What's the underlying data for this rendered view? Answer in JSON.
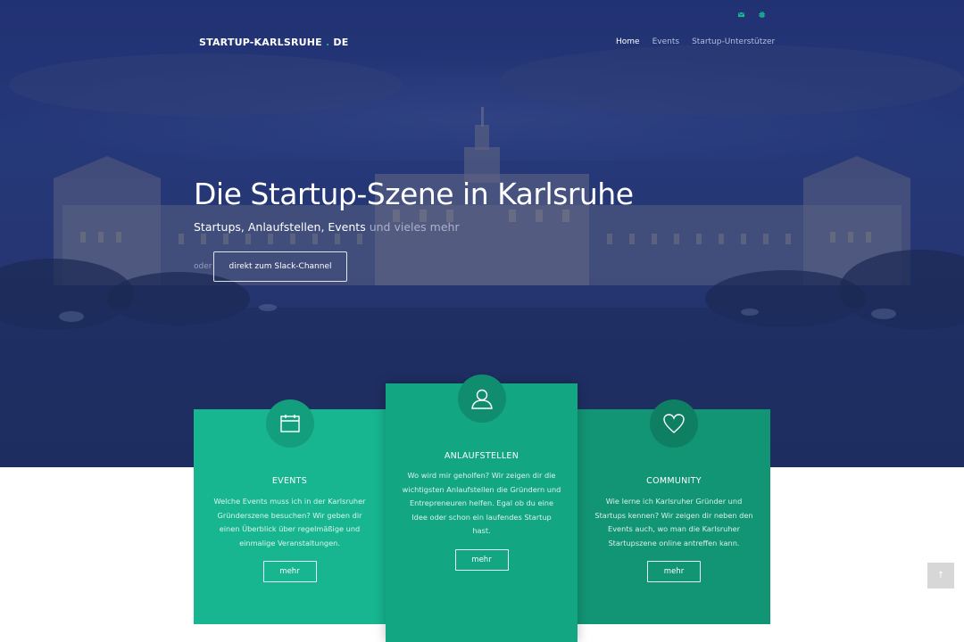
{
  "header": {
    "brand_main": "STARTUP-KARLSRUHE",
    "brand_dot": ".",
    "brand_tld": "DE",
    "icons": [
      "mail-icon",
      "slack-icon"
    ],
    "nav": [
      {
        "label": "Home",
        "active": true
      },
      {
        "label": "Events",
        "active": false
      },
      {
        "label": "Startup-Unterstützer",
        "active": false
      }
    ]
  },
  "hero": {
    "title": "Die Startup-Szene in Karlsruhe",
    "subtitle_strong": "Startups, Anlaufstellen, Events",
    "subtitle_muted": "und vieles mehr",
    "or_label": "oder",
    "slack_button": "direkt zum Slack-Channel"
  },
  "cards": [
    {
      "icon": "calendar-icon",
      "title": "EVENTS",
      "text": "Welche Events muss ich in der Karlsruher Gründerszene besuchen? Wir geben dir einen Überblick über regelmäßige und einmalige Veranstaltungen.",
      "button": "mehr"
    },
    {
      "icon": "user-icon",
      "title": "ANLAUFSTELLEN",
      "text": "Wo wird mir geholfen? Wir zeigen dir die wichtigsten Anlaufstellen die Gründern und Entrepreneuren helfen. Egal ob du eine Idee oder schon ein laufendes Startup hast.",
      "button": "mehr"
    },
    {
      "icon": "heart-icon",
      "title": "COMMUNITY",
      "text": "Wie lerne ich Karlsruher Gründer und Startups kennen? Wir zeigen dir neben den Events auch, wo man die Karlsruher Startupszene online antreffen kann.",
      "button": "mehr"
    }
  ],
  "scroll_top": {
    "icon": "arrow-up-icon",
    "glyph": "↑"
  },
  "colors": {
    "hero_overlay": "#243677",
    "accent": "#17b890",
    "card_events": "#17b690",
    "card_anlaufstellen": "#13a683",
    "card_community": "#129574"
  }
}
